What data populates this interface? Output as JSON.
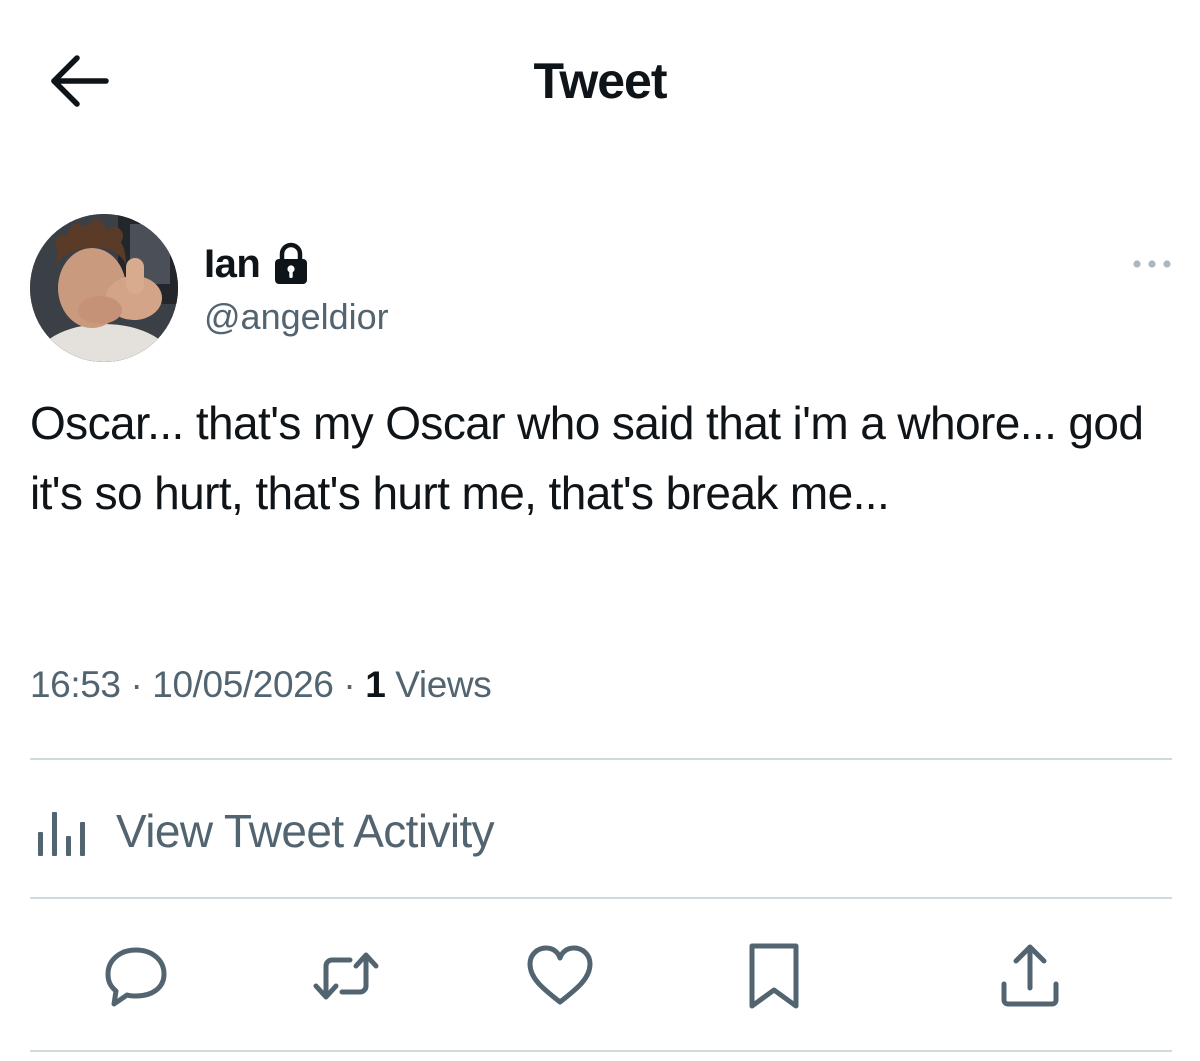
{
  "header": {
    "title": "Tweet",
    "back_icon": "arrow-left-icon"
  },
  "author": {
    "display_name": "Ian",
    "handle": "@angeldior",
    "protected_icon": "lock-icon",
    "avatar_icon": "profile-photo"
  },
  "more_icon": "more-dots-icon",
  "tweet": {
    "text": "Oscar... that's my Oscar who said that i'm a whore... god it's so hurt, that's hurt me, that's break me...",
    "time": "16:53",
    "date": "10/05/2026",
    "views_count": "1",
    "views_label": "Views",
    "separator": "·"
  },
  "activity": {
    "label": "View Tweet Activity",
    "icon": "bar-chart-icon"
  },
  "actions": [
    {
      "name": "reply",
      "icon": "reply-icon"
    },
    {
      "name": "retweet",
      "icon": "retweet-icon"
    },
    {
      "name": "like",
      "icon": "heart-icon"
    },
    {
      "name": "bookmark",
      "icon": "bookmark-icon"
    },
    {
      "name": "share",
      "icon": "share-icon"
    }
  ],
  "colors": {
    "text_primary": "#0f1419",
    "text_secondary": "#536471",
    "divider": "#cfd9de",
    "background": "#ffffff"
  }
}
